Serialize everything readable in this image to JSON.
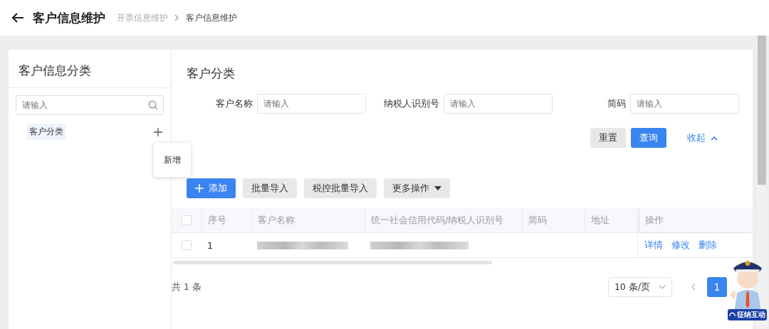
{
  "header": {
    "title": "客户信息维护",
    "breadcrumb": [
      {
        "label": "开票信息维护",
        "current": false
      },
      {
        "label": "客户信息维护",
        "current": true
      }
    ]
  },
  "sidebar": {
    "title": "客户信息分类",
    "search": {
      "placeholder": "请输入"
    },
    "tree": [
      {
        "label": "客户分类",
        "selected": true
      }
    ],
    "popover": {
      "label": "新增"
    }
  },
  "main": {
    "title": "客户分类",
    "filters": [
      {
        "label": "客户名称",
        "placeholder": "请输入"
      },
      {
        "label": "纳税人识别号",
        "placeholder": "请输入"
      },
      {
        "label": "简码",
        "placeholder": "请输入"
      }
    ],
    "form_buttons": [
      {
        "label": "重置",
        "kind": "default"
      },
      {
        "label": "查询",
        "kind": "primary"
      },
      {
        "label": "收起",
        "kind": "link"
      }
    ],
    "toolbar": [
      {
        "label": "添加",
        "kind": "primary"
      },
      {
        "label": "批量导入",
        "kind": "default"
      },
      {
        "label": "税控批量导入",
        "kind": "default"
      },
      {
        "label": "更多操作",
        "kind": "dropdown"
      }
    ],
    "table": {
      "all_checked": false,
      "columns": [
        "序号",
        "客户名称",
        "统一社会信用代码/纳税人识别号",
        "简码",
        "地址",
        "操作"
      ],
      "rows": [
        {
          "checked": false,
          "index": "1",
          "name": {
            "kind": "blurred"
          },
          "tax_id": {
            "kind": "blurred"
          },
          "actions": [
            "详情",
            "修改",
            "删除"
          ]
        }
      ]
    },
    "pagination": {
      "total": "共 1 条",
      "page_size": "10 条/页",
      "pages": [
        {
          "label": "1",
          "selected": true
        }
      ]
    }
  },
  "assistant": {
    "label": "征纳互动"
  }
}
